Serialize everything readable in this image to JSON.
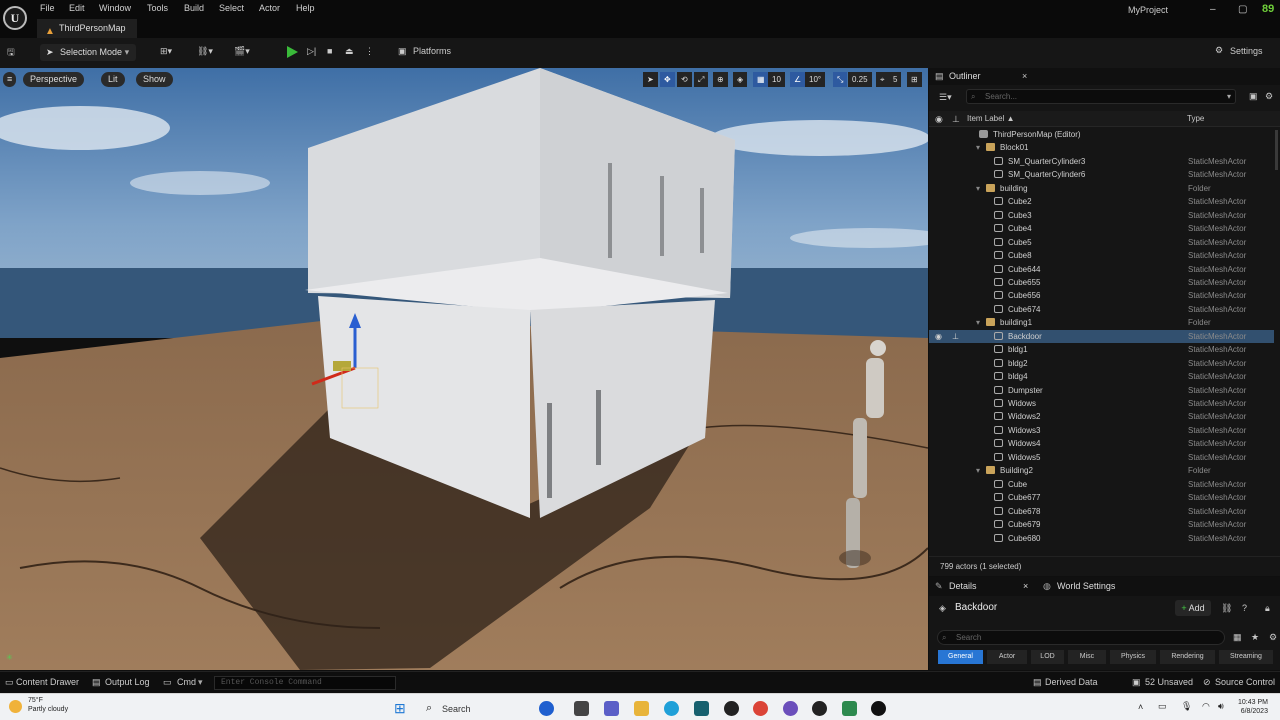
{
  "app": {
    "menu": [
      "File",
      "Edit",
      "Window",
      "Tools",
      "Build",
      "Select",
      "Actor",
      "Help"
    ],
    "map_tab": "ThirdPersonMap",
    "project": "MyProject"
  },
  "toolbar": {
    "selection_mode": "Selection Mode",
    "platforms": "Platforms",
    "settings": "Settings"
  },
  "viewport": {
    "perspective": "Perspective",
    "lit": "Lit",
    "show": "Show",
    "grid_snap": "10",
    "rot_snap": "10°",
    "scale_snap": "0.25",
    "cam_speed": "5"
  },
  "outliner": {
    "title": "Outliner",
    "search_placeholder": "Search...",
    "col_label": "Item Label ▲",
    "col_type": "Type",
    "rows": [
      {
        "label": "ThirdPersonMap (Editor)",
        "type": "",
        "kind": "map",
        "depth": 0
      },
      {
        "label": "Block01",
        "type": "",
        "kind": "folder",
        "depth": 1
      },
      {
        "label": "SM_QuarterCylinder3",
        "type": "StaticMeshActor",
        "kind": "mesh",
        "depth": 2
      },
      {
        "label": "SM_QuarterCylinder6",
        "type": "StaticMeshActor",
        "kind": "mesh",
        "depth": 2
      },
      {
        "label": "building",
        "type": "Folder",
        "kind": "folder",
        "depth": 1
      },
      {
        "label": "Cube2",
        "type": "StaticMeshActor",
        "kind": "mesh",
        "depth": 2
      },
      {
        "label": "Cube3",
        "type": "StaticMeshActor",
        "kind": "mesh",
        "depth": 2
      },
      {
        "label": "Cube4",
        "type": "StaticMeshActor",
        "kind": "mesh",
        "depth": 2
      },
      {
        "label": "Cube5",
        "type": "StaticMeshActor",
        "kind": "mesh",
        "depth": 2
      },
      {
        "label": "Cube8",
        "type": "StaticMeshActor",
        "kind": "mesh",
        "depth": 2
      },
      {
        "label": "Cube644",
        "type": "StaticMeshActor",
        "kind": "mesh",
        "depth": 2
      },
      {
        "label": "Cube655",
        "type": "StaticMeshActor",
        "kind": "mesh",
        "depth": 2
      },
      {
        "label": "Cube656",
        "type": "StaticMeshActor",
        "kind": "mesh",
        "depth": 2
      },
      {
        "label": "Cube674",
        "type": "StaticMeshActor",
        "kind": "mesh",
        "depth": 2
      },
      {
        "label": "building1",
        "type": "Folder",
        "kind": "folder",
        "depth": 1
      },
      {
        "label": "Backdoor",
        "type": "StaticMeshActor",
        "kind": "mesh",
        "depth": 2,
        "selected": true
      },
      {
        "label": "bldg1",
        "type": "StaticMeshActor",
        "kind": "mesh",
        "depth": 2
      },
      {
        "label": "bldg2",
        "type": "StaticMeshActor",
        "kind": "mesh",
        "depth": 2
      },
      {
        "label": "bldg4",
        "type": "StaticMeshActor",
        "kind": "mesh",
        "depth": 2
      },
      {
        "label": "Dumpster",
        "type": "StaticMeshActor",
        "kind": "mesh",
        "depth": 2
      },
      {
        "label": "Widows",
        "type": "StaticMeshActor",
        "kind": "mesh",
        "depth": 2
      },
      {
        "label": "Widows2",
        "type": "StaticMeshActor",
        "kind": "mesh",
        "depth": 2
      },
      {
        "label": "Widows3",
        "type": "StaticMeshActor",
        "kind": "mesh",
        "depth": 2
      },
      {
        "label": "Widows4",
        "type": "StaticMeshActor",
        "kind": "mesh",
        "depth": 2
      },
      {
        "label": "Widows5",
        "type": "StaticMeshActor",
        "kind": "mesh",
        "depth": 2
      },
      {
        "label": "Building2",
        "type": "Folder",
        "kind": "folder",
        "depth": 1
      },
      {
        "label": "Cube",
        "type": "StaticMeshActor",
        "kind": "mesh",
        "depth": 2
      },
      {
        "label": "Cube677",
        "type": "StaticMeshActor",
        "kind": "mesh",
        "depth": 2
      },
      {
        "label": "Cube678",
        "type": "StaticMeshActor",
        "kind": "mesh",
        "depth": 2
      },
      {
        "label": "Cube679",
        "type": "StaticMeshActor",
        "kind": "mesh",
        "depth": 2
      },
      {
        "label": "Cube680",
        "type": "StaticMeshActor",
        "kind": "mesh",
        "depth": 2
      }
    ],
    "footer": "799 actors (1 selected)"
  },
  "details": {
    "tab": "Details",
    "world_tab": "World Settings",
    "actor_name": "Backdoor",
    "add": "Add",
    "search_placeholder": "Search",
    "filters": [
      "General",
      "Actor",
      "LOD",
      "Misc",
      "Physics",
      "Rendering",
      "Streaming"
    ]
  },
  "statusbar": {
    "content_drawer": "Content Drawer",
    "output_log": "Output Log",
    "cmd": "Cmd",
    "console_placeholder": "Enter Console Command",
    "derived_data": "Derived Data",
    "unsaved": "52 Unsaved",
    "source_control": "Source Control"
  },
  "taskbar": {
    "temp": "75°F",
    "weather": "Partly cloudy",
    "search": "Search",
    "time": "10:43 PM",
    "date": "6/8/2023"
  }
}
